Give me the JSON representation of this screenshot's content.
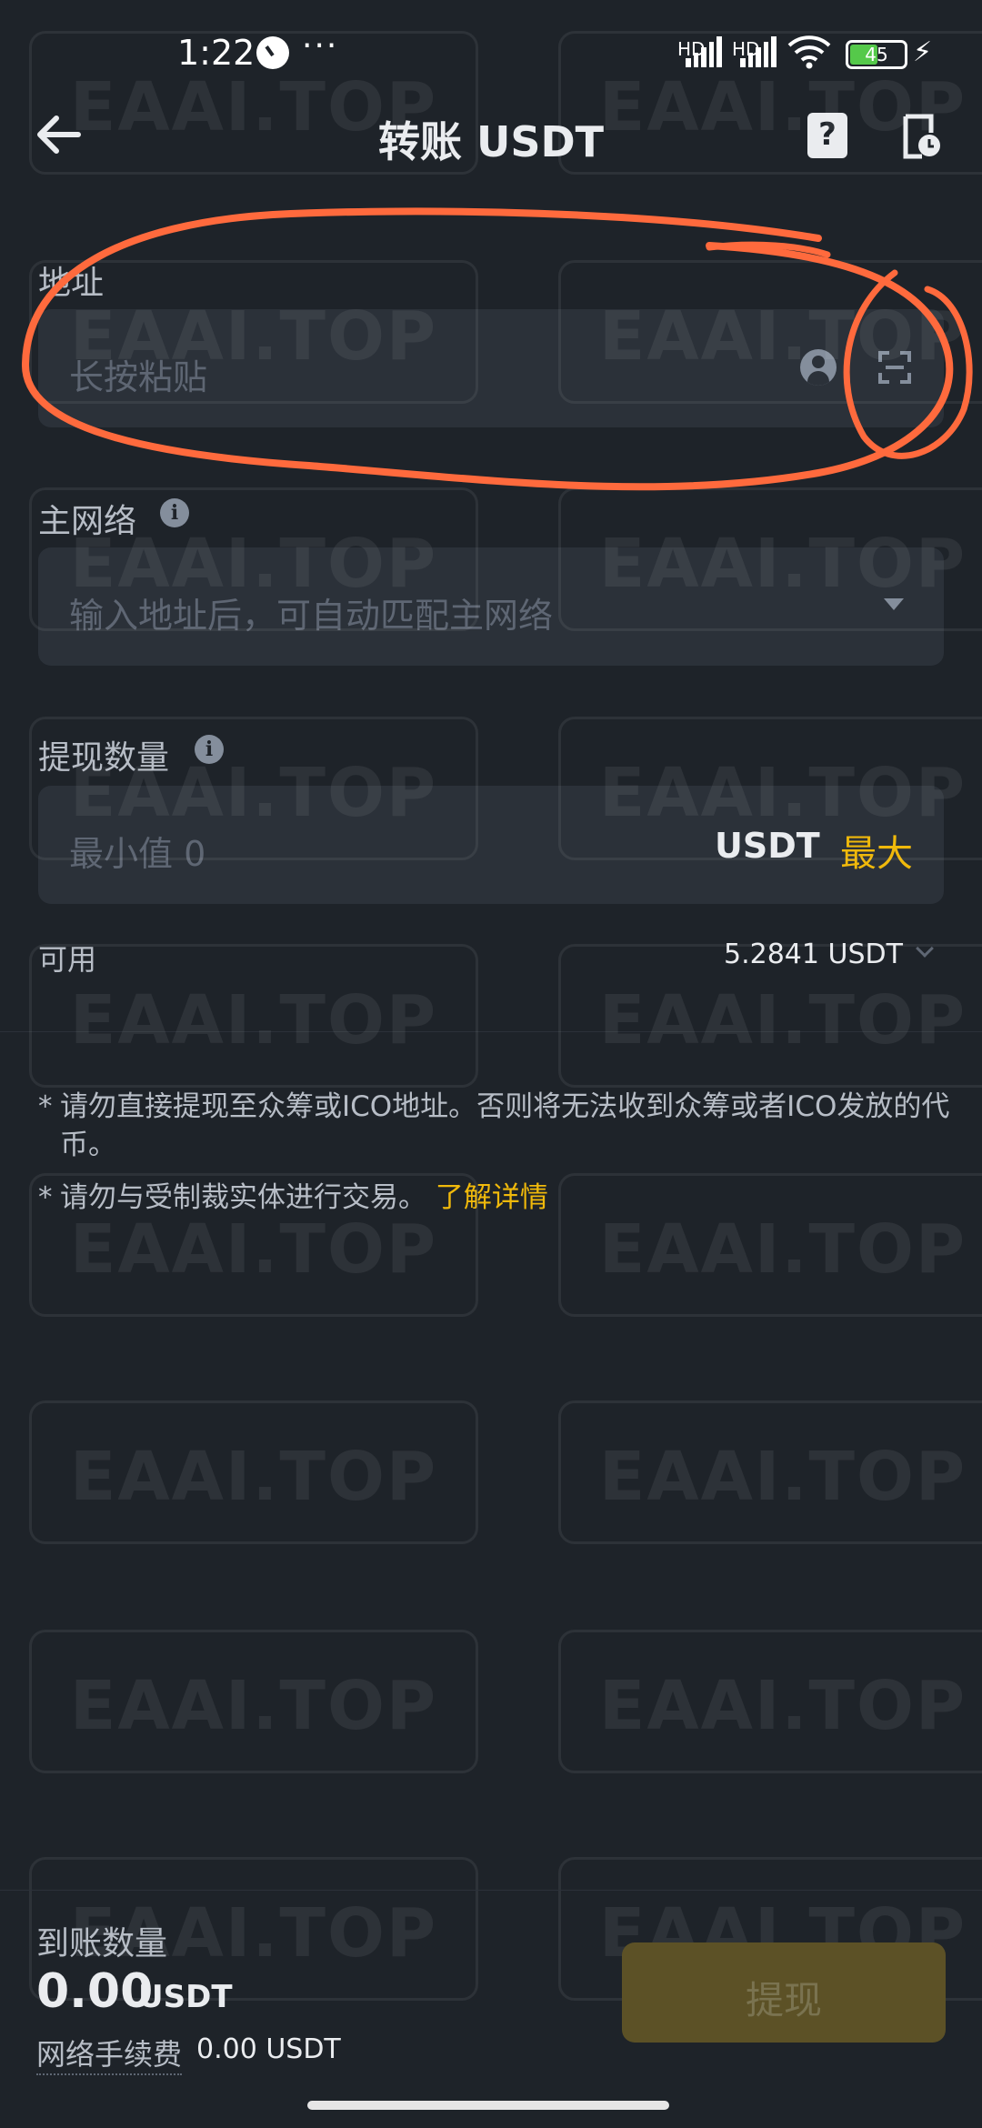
{
  "status_bar": {
    "time": "1:22",
    "more": "···",
    "net1": "HD",
    "net2": "HD",
    "battery_level": "45"
  },
  "header": {
    "title": "转账 USDT"
  },
  "address": {
    "label": "地址",
    "placeholder": "长按粘贴"
  },
  "network": {
    "label": "主网络",
    "placeholder": "输入地址后，可自动匹配主网络"
  },
  "amount": {
    "label": "提现数量",
    "placeholder": "最小值 0",
    "unit": "USDT",
    "max_label": "最大"
  },
  "available": {
    "label": "可用",
    "value": "5.2841 USDT"
  },
  "notes": {
    "note1": "请勿直接提现至众筹或ICO地址。否则将无法收到众筹或者ICO发放的代币。",
    "note2": "请勿与受制裁实体进行交易。",
    "link": "了解详情"
  },
  "bottom": {
    "receive_label": "到账数量",
    "receive_amount": "0.00",
    "receive_unit": "USDT",
    "fee_label": "网络手续费",
    "fee_value": "0.00 USDT",
    "withdraw_label": "提现"
  },
  "watermark": "EAAI.TOP",
  "colors": {
    "background": "#1e2329",
    "field": "#2b3139",
    "accent": "#f0b90b",
    "annotation": "#ff6a3d"
  }
}
